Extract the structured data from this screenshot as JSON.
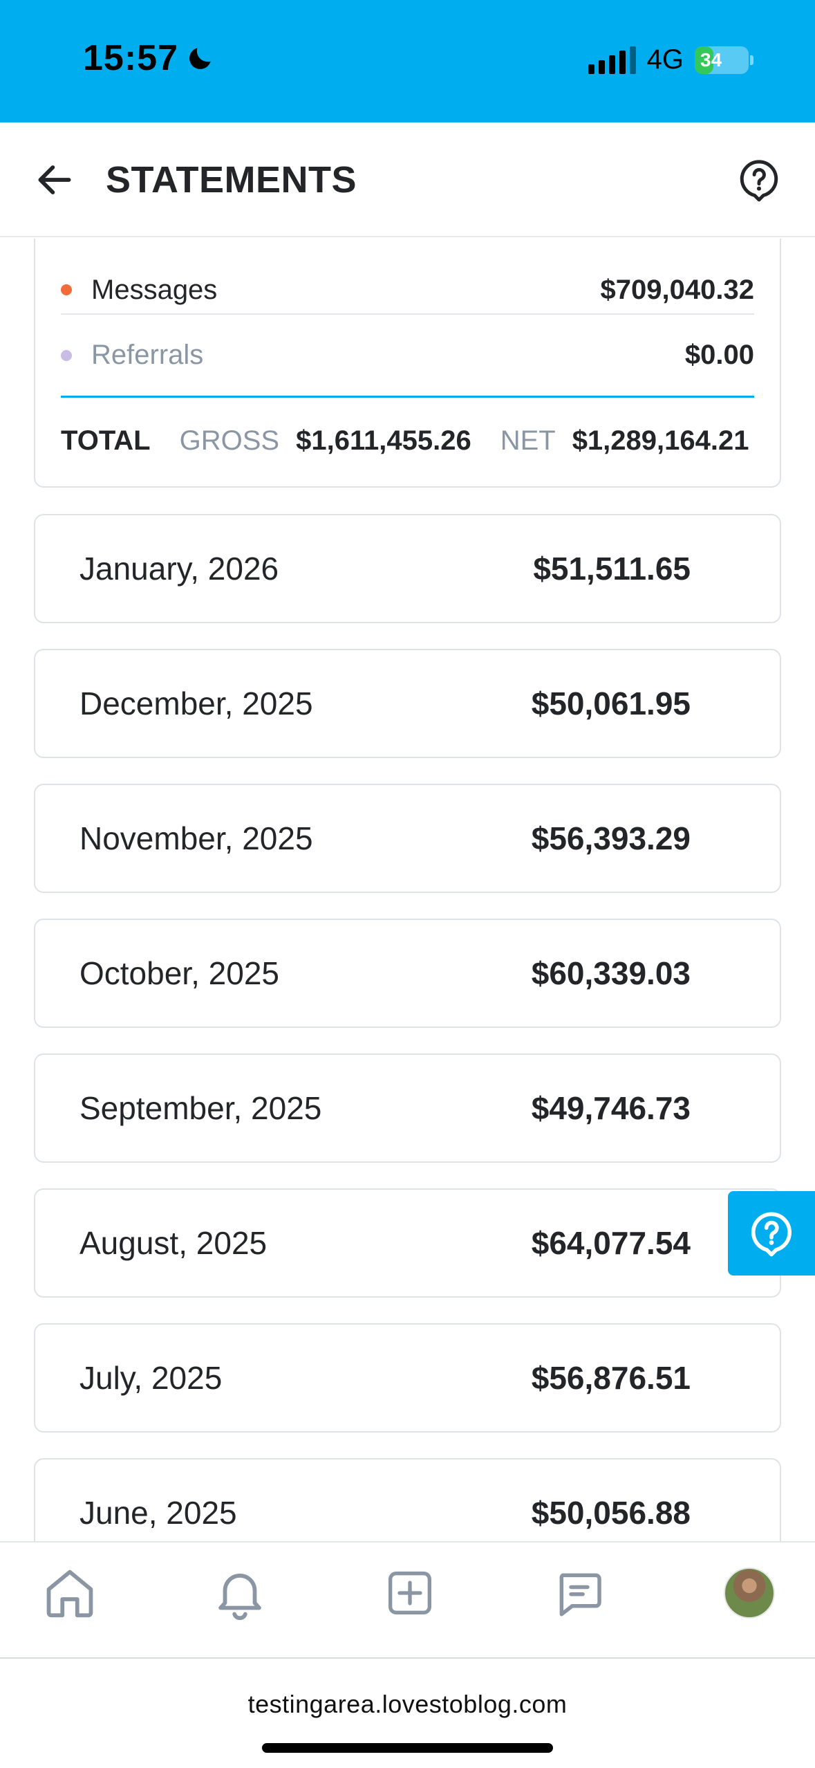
{
  "status_bar": {
    "time": "15:57",
    "network": "4G",
    "battery": "34",
    "battery_level": 0.34
  },
  "header": {
    "title": "STATEMENTS"
  },
  "summary": {
    "rows": [
      {
        "label": "Messages",
        "amount": "$709,040.32",
        "dot_color": "#f26b3a"
      },
      {
        "label": "Referrals",
        "amount": "$0.00",
        "dot_color": "#c9bde8"
      }
    ],
    "total_label": "TOTAL",
    "gross_label": "GROSS",
    "gross_value": "$1,611,455.26",
    "net_label": "NET",
    "net_value": "$1,289,164.21"
  },
  "months": [
    {
      "month": "January, 2026",
      "amount": "$51,511.65"
    },
    {
      "month": "December, 2025",
      "amount": "$50,061.95"
    },
    {
      "month": "November, 2025",
      "amount": "$56,393.29"
    },
    {
      "month": "October, 2025",
      "amount": "$60,339.03"
    },
    {
      "month": "September, 2025",
      "amount": "$49,746.73"
    },
    {
      "month": "August, 2025",
      "amount": "$64,077.54"
    },
    {
      "month": "July, 2025",
      "amount": "$56,876.51"
    },
    {
      "month": "June, 2025",
      "amount": "$50,056.88"
    }
  ],
  "bottom_nav": {
    "icons": [
      "home-icon",
      "bell-icon",
      "add-post-icon",
      "messages-icon",
      "avatar"
    ]
  },
  "browser": {
    "url": "testingarea.lovestoblog.com"
  },
  "colors": {
    "accent": "#00aeef",
    "text": "#242529",
    "muted": "#8a96a3",
    "border": "#dfe3e8"
  }
}
